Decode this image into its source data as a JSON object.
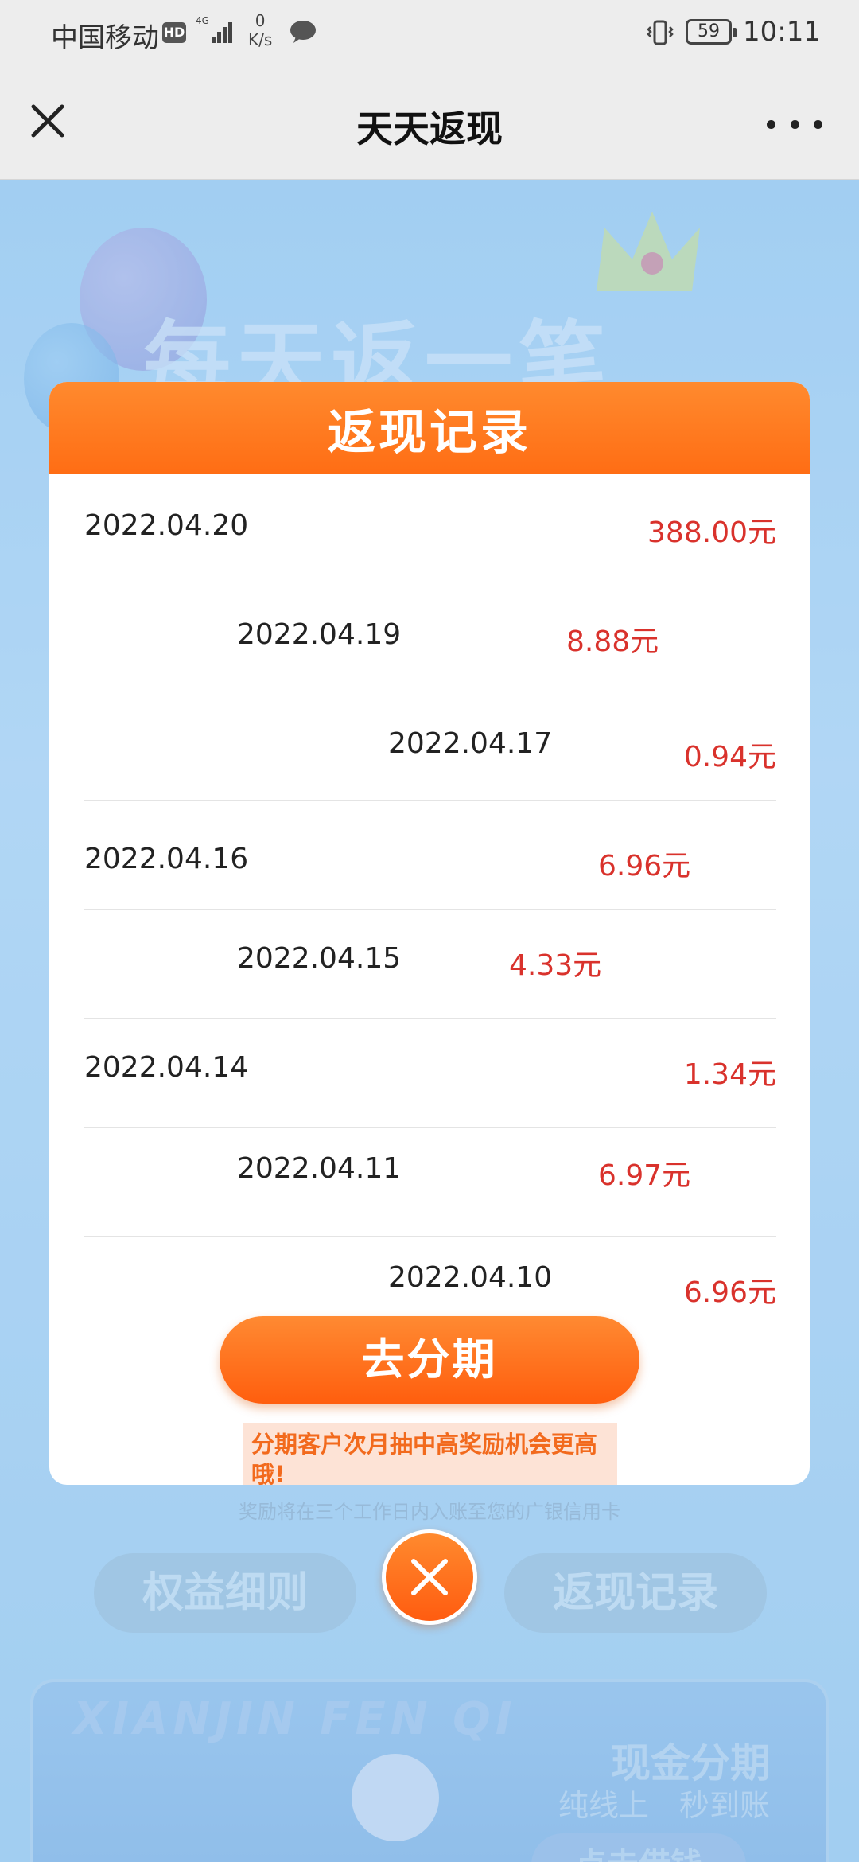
{
  "status_bar": {
    "carrier": "中国移动",
    "hd_badge": "HD",
    "network_speed_value": "0",
    "network_speed_unit": "K/s",
    "battery_level": "59",
    "time": "10:11"
  },
  "title_bar": {
    "title": "天天返现"
  },
  "background": {
    "banner_text": "每天返一笔",
    "hint": "奖励将在三个工作日内入账至您的广银信用卡",
    "left_button": "权益细则",
    "right_button": "返现记录",
    "promo": {
      "english_text": "XIANJIN FEN QI",
      "title": "现金分期",
      "subtitle": "纯线上　秒到账",
      "cta": "点击借钱"
    }
  },
  "modal": {
    "title": "返现记录",
    "records": [
      {
        "date": "2022.04.20",
        "amount": "388.00元"
      },
      {
        "date": "2022.04.19",
        "amount": "8.88元"
      },
      {
        "date": "2022.04.17",
        "amount": "0.94元"
      },
      {
        "date": "2022.04.16",
        "amount": "6.96元"
      },
      {
        "date": "2022.04.15",
        "amount": "4.33元"
      },
      {
        "date": "2022.04.14",
        "amount": "1.34元"
      },
      {
        "date": "2022.04.11",
        "amount": "6.97元"
      },
      {
        "date": "2022.04.10",
        "amount": "6.96元"
      }
    ],
    "cta_label": "去分期",
    "tip": "分期客户次月抽中高奖励机会更高哦!"
  },
  "colors": {
    "accent_orange": "#ff6d14",
    "amount_red": "#d9322c"
  }
}
